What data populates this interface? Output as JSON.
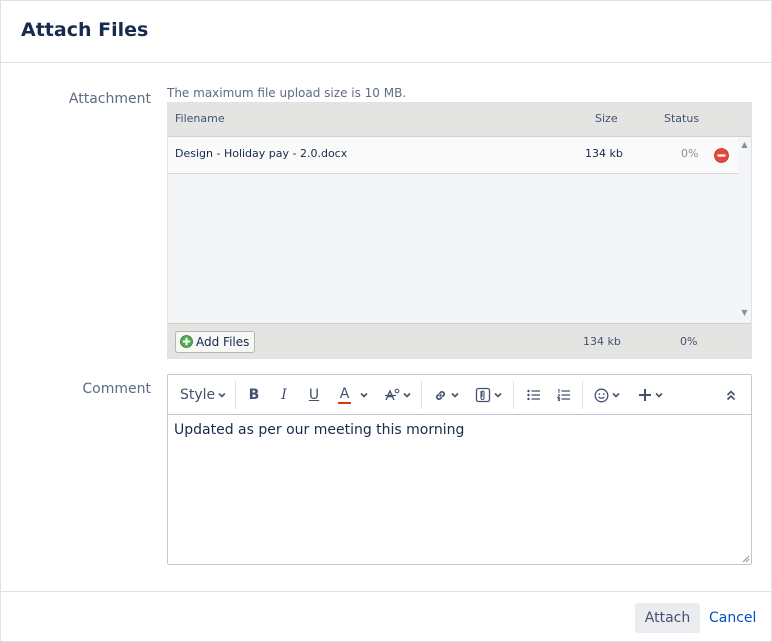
{
  "dialog": {
    "title": "Attach Files"
  },
  "attachment": {
    "label": "Attachment",
    "max_size_note": "The maximum file upload size is 10 MB.",
    "columns": {
      "filename": "Filename",
      "size": "Size",
      "status": "Status"
    },
    "files": [
      {
        "name": "Design - Holiday pay - 2.0.docx",
        "size": "134 kb",
        "status": "0%"
      }
    ],
    "footer": {
      "add_files_label": "Add Files",
      "total_size": "134 kb",
      "total_status": "0%"
    }
  },
  "comment": {
    "label": "Comment",
    "toolbar": {
      "style_label": "Style",
      "bold_glyph": "B",
      "italic_glyph": "I",
      "underline_glyph": "U",
      "text_color_glyph": "A",
      "icons": [
        "bold-icon",
        "italic-icon",
        "underline-icon",
        "text-color-icon",
        "text-effects-icon",
        "link-icon",
        "attachment-icon",
        "bullet-list-icon",
        "numbered-list-icon",
        "emoji-icon",
        "insert-plus-icon",
        "collapse-toolbar-icon"
      ],
      "text_color": "#de350b"
    },
    "value": "Updated as per our meeting this morning"
  },
  "footer": {
    "attach_label": "Attach",
    "cancel_label": "Cancel"
  },
  "colors": {
    "link": "#0052cc",
    "remove": "#de350b",
    "add": "#36b37e"
  }
}
